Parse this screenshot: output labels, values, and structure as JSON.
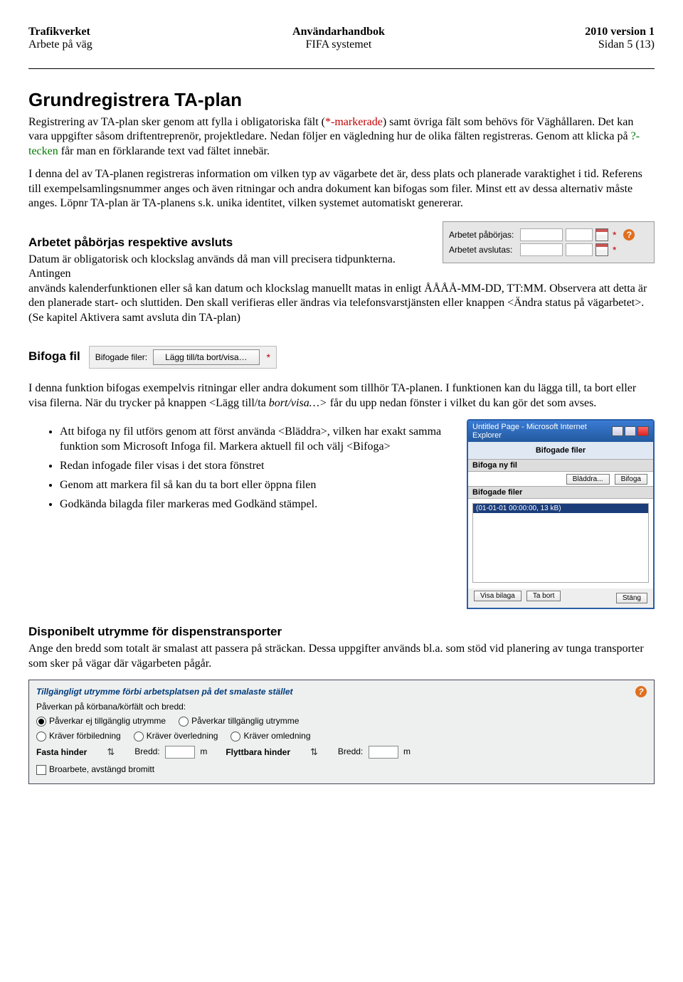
{
  "header": {
    "org": "Trafikverket",
    "org_sub": "Arbete på väg",
    "title": "Användarhandbok",
    "title_sub": "FIFA systemet",
    "version": "2010 version 1",
    "page": "Sidan 5 (13)"
  },
  "h1": "Grundregistrera TA-plan",
  "p1a": "Registrering av TA-plan sker genom att fylla i obligatoriska fält (",
  "p1b": "*-markerade",
  "p1c": ") samt övriga fält som behövs för Väghållaren. Det kan vara uppgifter såsom driftentreprenör, projektledare. Nedan följer en vägledning hur de olika fälten registreras. Genom att klicka på",
  "p1d": "?-tecken",
  "p1e": " får man en förklarande text vad fältet innebär.",
  "p2": "I denna del av TA-planen registreras information om vilken typ av vägarbete det är, dess plats och planerade varaktighet i tid. Referens till exempelsamlingsnummer anges och även ritningar och andra dokument kan bifogas som filer. Minst ett av dessa alternativ måste anges. Löpnr TA-plan är TA-planens s.k. unika identitet, vilken systemet automatiskt genererar.",
  "h2_start": "Arbetet påbörjas respektive avsluts",
  "p3_left": "Datum är obligatorisk och klockslag används då man vill precisera tidpunkterna. Antingen",
  "date_widget": {
    "lbl_start": "Arbetet påbörjas:",
    "lbl_end": "Arbetet avslutas:"
  },
  "p3_after": "används kalenderfunktionen eller så kan datum och klockslag manuellt matas in enligt ÅÅÅÅ-MM-DD,  TT:MM. Observera att detta är den planerade start- och sluttiden. Den skall verifieras eller ändras via telefonsvarstjänsten eller knappen <Ändra status på vägarbetet>. (Se kapitel Aktivera samt avsluta din TA-plan)",
  "h2_bifoga": "Bifoga fil",
  "bifoga_inline": {
    "label": "Bifogade filer:",
    "button": "Lägg till/ta bort/visa…",
    "star": "*"
  },
  "p4a": "I denna funktion bifogas exempelvis ritningar eller andra dokument som tillhör TA-planen. I funktionen kan du lägga till, ta bort eller visa filerna. När du trycker på knappen <Lägg till/ta ",
  "p4_italic": "bort/visa…>",
  "p4b": " får du upp nedan fönster i vilket du kan gör det som avses.",
  "bullets": [
    "Att bifoga ny fil utförs genom att först använda <Bläddra>, vilken har exakt samma funktion som Microsoft Infoga fil. Markera aktuell fil och välj <Bifoga>",
    "Redan infogade filer visas i det stora fönstret",
    "Genom att markera fil så kan du ta bort eller öppna filen",
    "Godkända bilagda filer markeras med Godkänd stämpel."
  ],
  "popup": {
    "title": "Untitled Page - Microsoft Internet Explorer",
    "heading": "Bifogade filer",
    "sec1": "Bifoga ny fil",
    "btn_browse": "Bläddra...",
    "btn_attach": "Bifoga",
    "sec2": "Bifogade filer",
    "file_sel": "(01-01-01 00:00:00, 13 kB)",
    "btn_show": "Visa bilaga",
    "btn_remove": "Ta bort",
    "btn_close": "Stäng"
  },
  "h2_disp": "Disponibelt utrymme för dispenstransporter",
  "p_disp": "Ange den bredd som totalt är smalast att passera på sträckan. Dessa uppgifter används bl.a. som stöd vid planering av tunga transporter som sker på vägar där vägarbeten pågår.",
  "space": {
    "head": "Tillgängligt utrymme förbi arbetsplatsen på det smalaste stället",
    "sub": "Påverkan på körbana/körfält och bredd:",
    "r1": "Påverkar ej tillgänglig utrymme",
    "r2": "Påverkar tillgänglig utrymme",
    "r3": "Kräver förbiledning",
    "r4": "Kräver överledning",
    "r5": "Kräver omledning",
    "fixed": "Fasta hinder",
    "movable": "Flyttbara hinder",
    "bredd": "Bredd:",
    "unit": "m",
    "cb": "Broarbete, avstängd bromitt"
  },
  "help_q": "?"
}
